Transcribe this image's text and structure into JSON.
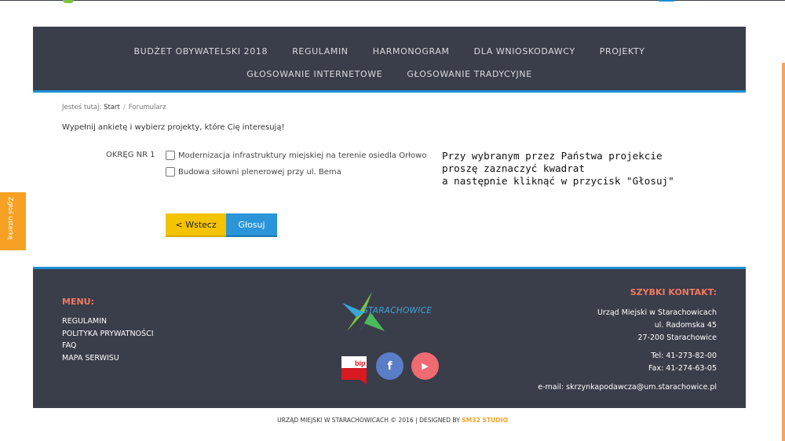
{
  "nav": {
    "row1": [
      "BUDŻET OBYWATELSKI 2018",
      "REGULAMIN",
      "HARMONOGRAM",
      "DLA WNIOSKODAWCY",
      "PROJEKTY"
    ],
    "row2": [
      "GŁOSOWANIE INTERNETOWE",
      "GŁOSOWANIE TRADYCYJNE"
    ]
  },
  "breadcrumb": {
    "prefix": "Jesteś tutaj:",
    "start": "Start",
    "separator": "/",
    "current": "Forumularz"
  },
  "intro": "Wypełnij ankietę i wybierz projekty, które Cię interesują!",
  "district": {
    "label": "OKRĘG NR 1",
    "options": [
      "Modernizacja infrastruktury miejskiej na terenie osiedla Orłowo",
      "Budowa siłowni plenerowej przy ul. Bema"
    ]
  },
  "instructions": [
    "Przy wybranym przez Państwa projekcie",
    "proszę zaznaczyć kwadrat",
    "a następnie kliknąć w przycisk \"Głosuj\""
  ],
  "buttons": {
    "back": "< Wstecz",
    "vote": "Głosuj"
  },
  "side_tab": "Zgłoś usterkę",
  "footer": {
    "menu_title": "MENU:",
    "menu": [
      "REGULAMIN",
      "POLITYKA PRYWATNOŚCI",
      "FAQ",
      "MAPA SERWISU"
    ],
    "logo_text": "STARACHOWICE",
    "bip_text": "bip",
    "contact_title": "SZYBKI KONTAKT:",
    "contact": {
      "office": "Urząd Miejski w Starachowicach",
      "street": "ul. Radomska 45",
      "city": "27-200 Starachowice",
      "tel": "Tel: 41-273-82-00",
      "fax": "Fax: 41-274-63-05",
      "email": "e-mail: skrzynkapodawcza@um.starachowice.pl"
    }
  },
  "copyright": {
    "text": "URZĄD MIEJSKI W STARACHOWICACH © 2016 | DESIGNED BY ",
    "studio": "SM32 STUDIO"
  },
  "colors": {
    "nav_bg": "#3a3d4a",
    "accent_blue": "#1c8fd6",
    "accent_red": "#f07a63",
    "back_button": "#f5c400",
    "vote_button": "#2a95d8",
    "side_tab": "#f6a124"
  },
  "icons": {
    "facebook": "facebook-icon",
    "youtube": "youtube-icon",
    "bip": "bip-icon"
  }
}
